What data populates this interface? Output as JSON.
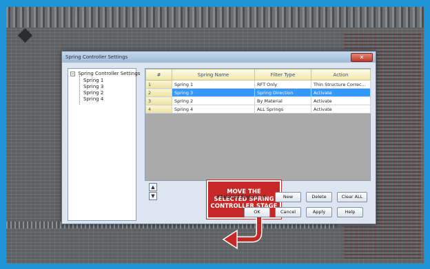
{
  "dialog": {
    "title": "Spring Controller Settings",
    "close_glyph": "✕"
  },
  "tree": {
    "root_label": "Spring Controller Settings",
    "expander": "−",
    "children": [
      "Spring 1",
      "Spring 3",
      "Spring 2",
      "Spring 4"
    ]
  },
  "table": {
    "headers": [
      "#",
      "Spring Name",
      "Filter Type",
      "Action"
    ],
    "selected_row": 1,
    "rows": [
      {
        "num": "1",
        "name": "Spring 1",
        "filter": "RFT Only",
        "action": "Thin Structure Correc..."
      },
      {
        "num": "2",
        "name": "Spring 3",
        "filter": "Spring Direction",
        "action": "Activate"
      },
      {
        "num": "3",
        "name": "Spring 2",
        "filter": "By Material",
        "action": "Activate"
      },
      {
        "num": "4",
        "name": "Spring 4",
        "filter": "ALL Springs",
        "action": "Activate"
      }
    ]
  },
  "callout": {
    "line1": "MOVE THE",
    "line2": "SELECTED SPRING",
    "line3": "CONTROLLER STAGE"
  },
  "move_buttons": {
    "up": "▲",
    "down": "▼"
  },
  "footer": {
    "selected_regions": "#Selected Regions : 0",
    "new_label": "New",
    "delete_label": "Delete",
    "clear_all_label": "Clear ALL",
    "ok_label": "OK",
    "cancel_label": "Cancel",
    "apply_label": "Apply",
    "help_label": "Help"
  },
  "colors": {
    "frame": "#1e94d6",
    "selection": "#3399ff",
    "callout": "#c62828"
  }
}
